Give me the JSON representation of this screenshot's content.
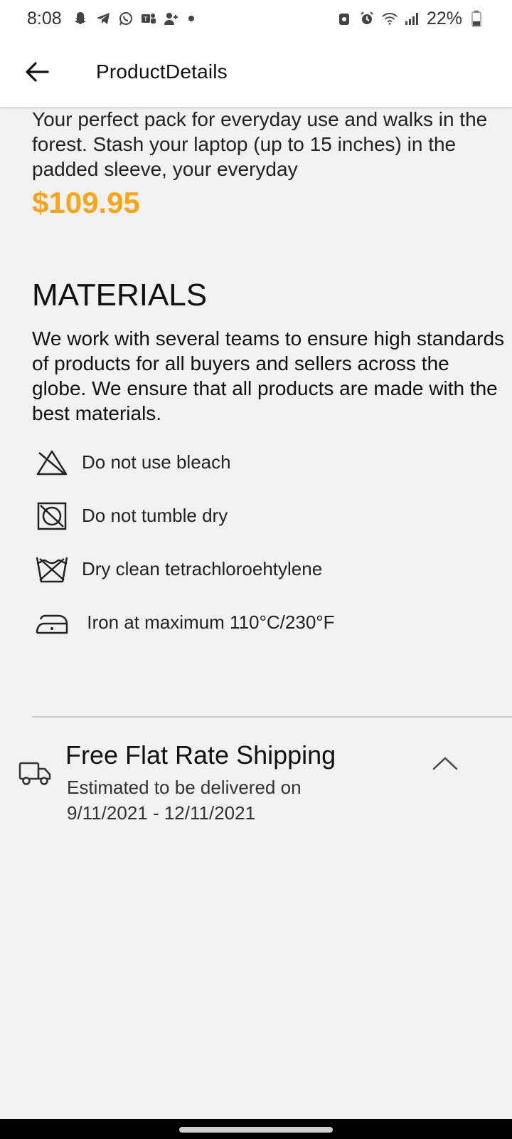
{
  "status_bar": {
    "time": "8:08",
    "battery": "22%"
  },
  "app_bar": {
    "title": "ProductDetails"
  },
  "product": {
    "description_lines": [
      "Your perfect pack for everyday use and walks in the",
      "forest. Stash your laptop (up to 15 inches) in the",
      "padded sleeve, your everyday"
    ],
    "price": "$109.95"
  },
  "materials": {
    "title": "MATERIALS",
    "text_lines": [
      "We work with several teams to ensure high standards",
      "of products for all buyers and sellers across the",
      "globe. We ensure that all products are made with the",
      "best materials."
    ],
    "care": [
      {
        "icon": "no-bleach-icon",
        "label": "Do not use bleach"
      },
      {
        "icon": "no-tumble-dry-icon",
        "label": "Do not tumble dry"
      },
      {
        "icon": "dry-clean-icon",
        "label": "Dry clean tetrachloroehtylene"
      },
      {
        "icon": "iron-icon",
        "label": " Iron at maximum 110°C/230°F"
      }
    ]
  },
  "shipping": {
    "title": "Free Flat Rate Shipping",
    "subtitle_line1": "Estimated to be delivered on",
    "subtitle_line2": "9/11/2021 - 12/11/2021"
  },
  "colors": {
    "price": "#f7a51d",
    "background": "#f1f1f1"
  }
}
